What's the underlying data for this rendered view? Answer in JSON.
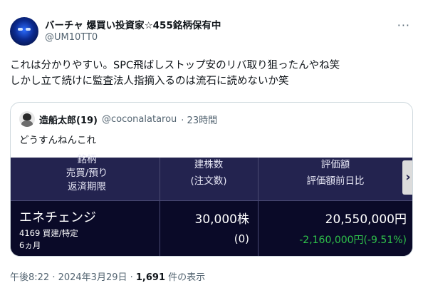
{
  "author": {
    "display_name": "バーチャ 爆買い投資家☆455銘柄保有中",
    "handle": "@UM10TT0",
    "more_icon": "more-icon"
  },
  "tweet": {
    "lines": [
      "これは分かりやすい。SPC飛ばしストップ安のリバ取り狙ったんやね笑",
      "しかし立て続けに監査法人指摘入るのは流石に読めないか笑"
    ]
  },
  "quote": {
    "name": "造船太郎(19)",
    "handle": "@coconalatarou",
    "time": "· 23時間",
    "text": "どうすんねんこれ",
    "stock_table": {
      "headers": {
        "col1": [
          "銘柄",
          "売買/預り",
          "返済期限"
        ],
        "col2": [
          "建株数",
          "(注文数)"
        ],
        "col3": [
          "評価額",
          "評価額前日比"
        ]
      },
      "scroll_icon": "chevron-right-icon",
      "row": {
        "name": "エネチェンジ",
        "code_line": "4169 買建/特定",
        "term": "6ヵ月",
        "quantity": "30,000株",
        "order_qty": "(0)",
        "value": "20,550,000円",
        "change": "-2,160,000円(-9.51%)"
      },
      "colors": {
        "header_bg": "#23234f",
        "row_bg": "#0a0a28",
        "change": "#2fc24a"
      }
    }
  },
  "meta": {
    "time": "午後8:22 · 2024年3月29日 · ",
    "views_count": "1,691",
    "views_label": " 件の表示"
  }
}
